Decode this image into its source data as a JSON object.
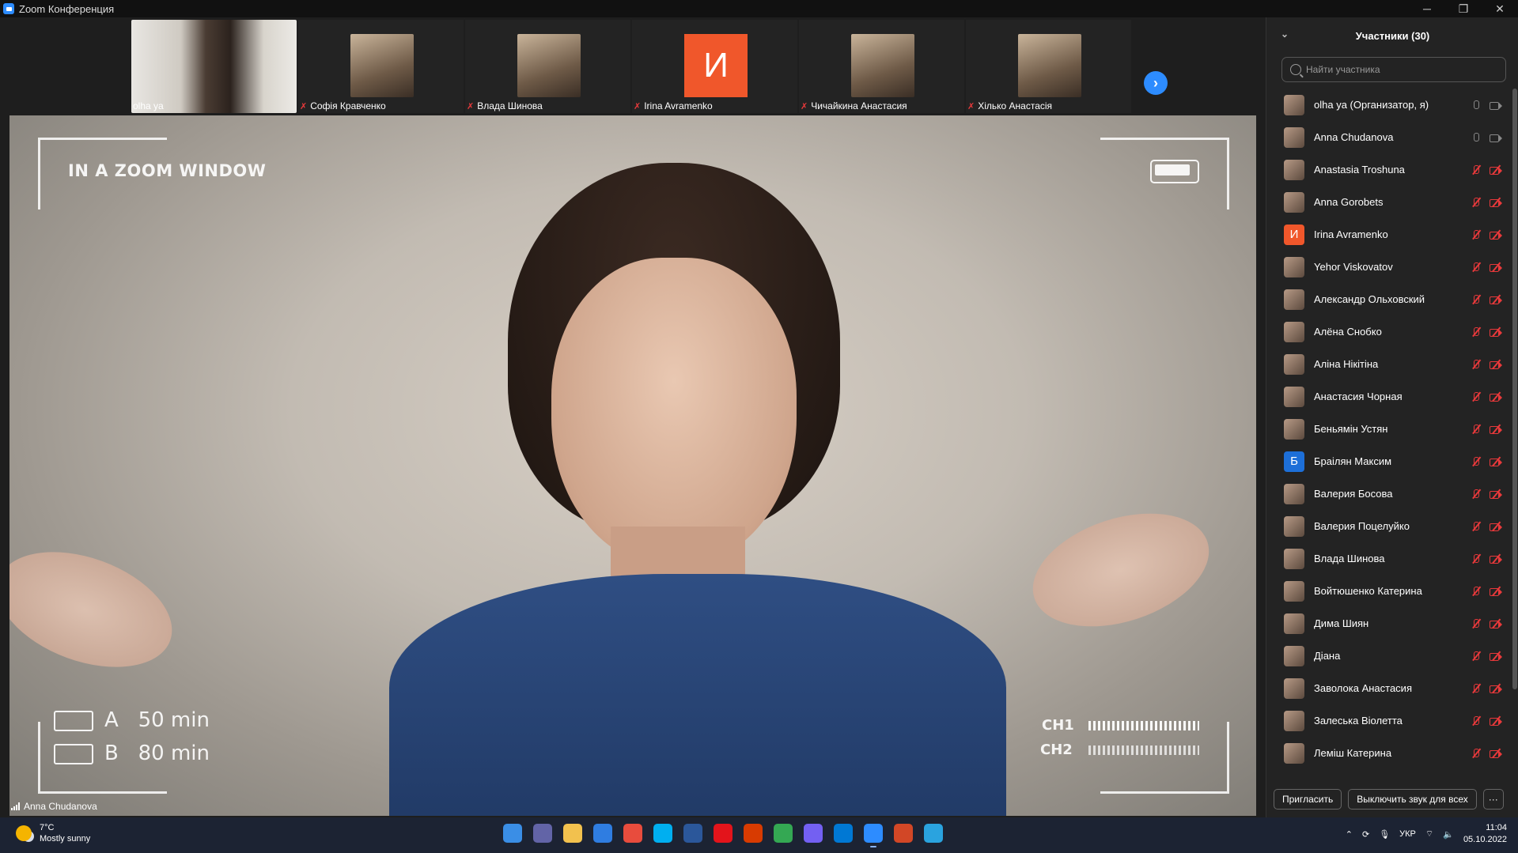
{
  "window": {
    "title": "Zoom Конференция",
    "controls": [
      "─",
      "❐",
      "✕"
    ]
  },
  "gallery": {
    "tiles": [
      {
        "name": "olha ya",
        "muted": false,
        "big": true
      },
      {
        "name": "Софія Кравченко",
        "muted": true
      },
      {
        "name": "Влада Шинова",
        "muted": true
      },
      {
        "name": "Irina Avramenko",
        "muted": true,
        "letter": "И"
      },
      {
        "name": "Чичайкина Анастасия",
        "muted": true
      },
      {
        "name": "Хілько  Анастасія",
        "muted": true
      }
    ],
    "next_symbol": "›"
  },
  "main_video": {
    "overlay_title": "IN A ZOOM WINDOW",
    "line_a": "A   50 min",
    "line_b": "B   80 min",
    "ch1": "CH1",
    "ch2": "CH2",
    "speaker": "Anna Chudanova"
  },
  "participants": {
    "header": "Участники (30)",
    "search_placeholder": "Найти участника",
    "list": [
      {
        "name": "olha ya (Организатор, я)",
        "muted": false
      },
      {
        "name": "Anna Chudanova",
        "muted": false
      },
      {
        "name": "Anastasia Troshuna",
        "muted": true
      },
      {
        "name": "Anna Gorobets",
        "muted": true
      },
      {
        "name": "Irina Avramenko",
        "muted": true,
        "letter": "И"
      },
      {
        "name": "Yehor Viskovatov",
        "muted": true
      },
      {
        "name": "Александр Ольховский",
        "muted": true
      },
      {
        "name": "Алёна Снобко",
        "muted": true
      },
      {
        "name": "Аліна Нікітіна",
        "muted": true
      },
      {
        "name": "Анастасия Чорная",
        "muted": true
      },
      {
        "name": "Беньямін Устян",
        "muted": true
      },
      {
        "name": "Браілян Максим",
        "muted": true,
        "letter": "Б",
        "blue": true
      },
      {
        "name": "Валерия Босова",
        "muted": true
      },
      {
        "name": "Валерия Поцелуйко",
        "muted": true
      },
      {
        "name": "Влада Шинова",
        "muted": true
      },
      {
        "name": "Войтюшенко Катерина",
        "muted": true
      },
      {
        "name": "Дима Шиян",
        "muted": true
      },
      {
        "name": "Діана",
        "muted": true
      },
      {
        "name": "Заволока Анастасия",
        "muted": true
      },
      {
        "name": "Залеська Віолетта",
        "muted": true
      },
      {
        "name": "Леміш Катерина",
        "muted": true
      }
    ],
    "invite_label": "Пригласить",
    "mute_all_label": "Выключить звук для всех",
    "more_label": "···"
  },
  "taskbar": {
    "weather_temp": "7°C",
    "weather_desc": "Mostly sunny",
    "apps": [
      {
        "name": "windows-start-icon",
        "color": "#3a8ee6"
      },
      {
        "name": "teams-chat-icon",
        "color": "#6264a7"
      },
      {
        "name": "file-explorer-icon",
        "color": "#f2c14e"
      },
      {
        "name": "store-icon",
        "color": "#2f7de1"
      },
      {
        "name": "chrome-icon",
        "color": "#e84c3d"
      },
      {
        "name": "skype-icon",
        "color": "#00aff0"
      },
      {
        "name": "word-icon",
        "color": "#2b579a"
      },
      {
        "name": "acrobat-icon",
        "color": "#e3141b"
      },
      {
        "name": "office-icon",
        "color": "#d83b01"
      },
      {
        "name": "chrome-2-icon",
        "color": "#34a853"
      },
      {
        "name": "viber-icon",
        "color": "#7360f2"
      },
      {
        "name": "photos-icon",
        "color": "#0078d4"
      },
      {
        "name": "zoom-icon",
        "color": "#2d8cff",
        "active": true
      },
      {
        "name": "powerpoint-icon",
        "color": "#d24726"
      },
      {
        "name": "telegram-icon",
        "color": "#2aa3df"
      }
    ],
    "lang": "УКР",
    "time": "11:04",
    "date": "05.10.2022"
  }
}
